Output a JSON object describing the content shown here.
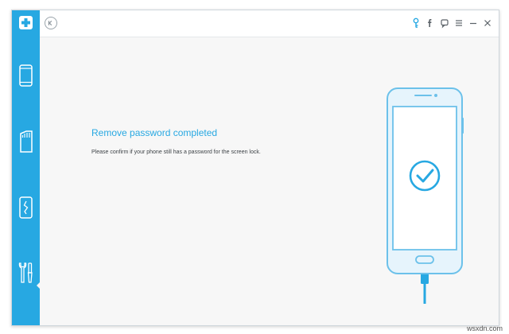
{
  "app": {
    "logo_icon": "plus-icon",
    "accent_color": "#27a8e2"
  },
  "titlebar": {
    "back_icon": "back-circle-icon",
    "actions": [
      "key-icon",
      "facebook-icon",
      "feedback-icon",
      "menu-icon",
      "minimize-icon",
      "close-icon"
    ]
  },
  "sidebar": {
    "items": [
      {
        "icon": "phone-icon",
        "active": false
      },
      {
        "icon": "sd-card-icon",
        "active": false
      },
      {
        "icon": "broken-phone-icon",
        "active": false
      },
      {
        "icon": "tools-icon",
        "active": true
      }
    ]
  },
  "main": {
    "headline": "Remove password completed",
    "message": "Please confirm if your phone still has a password for the screen lock.",
    "illustration": "phone-success-check-icon"
  },
  "watermark": "wsxdn.com"
}
